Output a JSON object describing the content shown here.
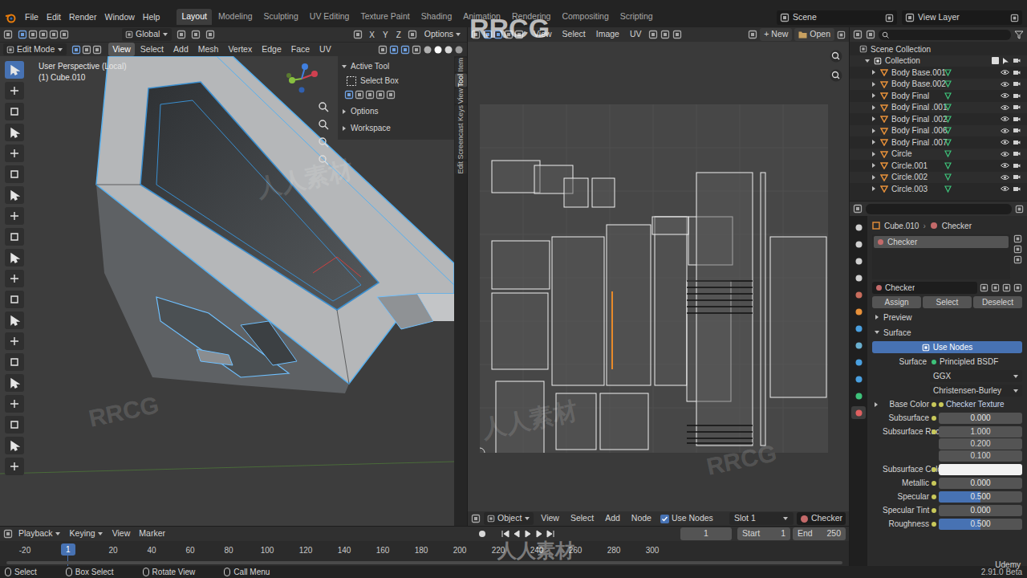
{
  "top_menu": [
    "File",
    "Edit",
    "Render",
    "Window",
    "Help"
  ],
  "workspaces": [
    {
      "label": "Layout",
      "selected": true
    },
    {
      "label": "Modeling",
      "selected": false
    },
    {
      "label": "Sculpting",
      "selected": false
    },
    {
      "label": "UV Editing",
      "selected": false
    },
    {
      "label": "Texture Paint",
      "selected": false
    },
    {
      "label": "Shading",
      "selected": false
    },
    {
      "label": "Animation",
      "selected": false
    },
    {
      "label": "Rendering",
      "selected": false
    },
    {
      "label": "Compositing",
      "selected": false
    },
    {
      "label": "Scripting",
      "selected": false
    }
  ],
  "scene": "Scene",
  "view_layer": "View Layer",
  "viewport": {
    "orientation": "Global",
    "axes": [
      "X",
      "Y",
      "Z"
    ],
    "options": "Options",
    "mode": "Edit Mode",
    "menus": [
      {
        "label": "View",
        "selected": true
      },
      {
        "label": "Select",
        "selected": false
      },
      {
        "label": "Add",
        "selected": false
      },
      {
        "label": "Mesh",
        "selected": false
      },
      {
        "label": "Vertex",
        "selected": false
      },
      {
        "label": "Edge",
        "selected": false
      },
      {
        "label": "Face",
        "selected": false
      },
      {
        "label": "UV",
        "selected": false
      }
    ],
    "info": [
      "User Perspective (Local)",
      "(1) Cube.010"
    ],
    "tools": [
      {
        "selected": true
      },
      {
        "selected": false
      },
      {
        "selected": false
      },
      {
        "selected": false
      },
      {
        "selected": false
      },
      {
        "selected": false
      },
      {
        "selected": false
      },
      {
        "selected": false
      },
      {
        "selected": false
      },
      {
        "selected": false
      },
      {
        "selected": false
      },
      {
        "selected": false
      },
      {
        "selected": false
      },
      {
        "selected": false
      },
      {
        "selected": false
      },
      {
        "selected": false
      },
      {
        "selected": false
      },
      {
        "selected": false
      },
      {
        "selected": false
      },
      {
        "selected": false
      }
    ],
    "n_panel": {
      "sections": [
        {
          "label": "Active Tool",
          "expanded": true
        },
        {
          "label": "Options",
          "expanded": false
        },
        {
          "label": "Workspace",
          "expanded": false
        }
      ],
      "tool": "Select Box"
    },
    "side_tabs": [
      {
        "label": "Item",
        "selected": false
      },
      {
        "label": "Tool",
        "selected": true
      },
      {
        "label": "View",
        "selected": false
      },
      {
        "label": "Screencast Keys",
        "selected": false
      },
      {
        "label": "Edit",
        "selected": false
      }
    ]
  },
  "uv_editor": {
    "menus": [
      "View",
      "Select",
      "Image",
      "UV"
    ],
    "new": "New",
    "open": "Open"
  },
  "node_header": {
    "mode": "Object",
    "menus": [
      "View",
      "Select",
      "Add",
      "Node"
    ],
    "use_nodes": {
      "label": "Use Nodes",
      "checked": true
    },
    "slot": "Slot 1",
    "material": "Checker"
  },
  "outliner": {
    "root": "Scene Collection",
    "collection": "Collection",
    "items": [
      "Body Base.001",
      "Body Base.002",
      "Body Final",
      "Body Final .001",
      "Body Final .002",
      "Body Final .006",
      "Body Final .007",
      "Circle",
      "Circle.001",
      "Circle.002",
      "Circle.003"
    ]
  },
  "properties": {
    "object": "Cube.010",
    "material": "Checker",
    "slots": [
      {
        "label": "Checker",
        "selected": true
      }
    ],
    "material_field": "Checker",
    "buttons": [
      "Assign",
      "Select",
      "Deselect"
    ],
    "panels": [
      {
        "label": "Preview",
        "expanded": false
      },
      {
        "label": "Surface",
        "expanded": true
      }
    ],
    "use_nodes": "Use Nodes",
    "surface_label": "Surface",
    "surface": "Principled BSDF",
    "distribution": "GGX",
    "subsurface_method": "Christensen-Burley",
    "fields": [
      {
        "label": "Base Color",
        "kind": "link",
        "value": "Checker Texture"
      },
      {
        "label": "Subsurface",
        "kind": "number",
        "value": "0.000",
        "level": 0
      },
      {
        "label": "Subsurface Radi",
        "kind": "vector",
        "values": [
          "1.000",
          "0.200",
          "0.100"
        ]
      },
      {
        "label": "Subsurface Color",
        "kind": "color",
        "color": "#f2f2f2"
      },
      {
        "label": "Metallic",
        "kind": "number",
        "value": "0.000",
        "level": 0
      },
      {
        "label": "Specular",
        "kind": "number",
        "value": "0.500",
        "level": 0.5
      },
      {
        "label": "Specular Tint",
        "kind": "number",
        "value": "0.000",
        "level": 0
      },
      {
        "label": "Roughness",
        "kind": "number",
        "value": "0.500",
        "level": 0.5
      }
    ]
  },
  "timeline": {
    "menus": [
      "Playback",
      "Keying",
      "View",
      "Marker"
    ],
    "frame": "1",
    "start_label": "Start",
    "start": "1",
    "end_label": "End",
    "end": "250",
    "ruler": [
      "-20",
      "20",
      "40",
      "60",
      "80",
      "100",
      "120",
      "140",
      "160",
      "180",
      "200",
      "220",
      "240",
      "260",
      "280",
      "300"
    ],
    "current": "1"
  },
  "status_bar": {
    "items": [
      "Select",
      "Box Select",
      "Rotate View",
      "Call Menu"
    ],
    "version": "2.91.0 Beta"
  },
  "watermarks": [
    "RRCG",
    "人人素材",
    "Udemy"
  ]
}
